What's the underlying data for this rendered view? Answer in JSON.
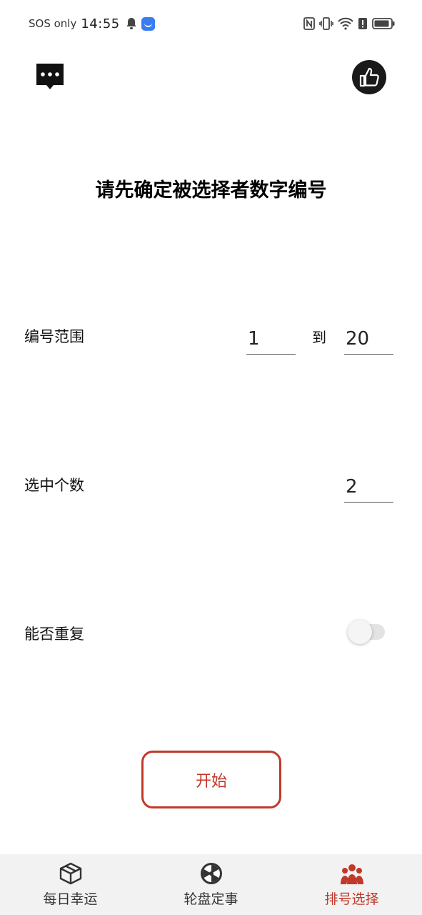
{
  "status_bar": {
    "carrier": "SOS only",
    "time": "14:55",
    "icons": [
      "bell-icon",
      "app-notification-icon",
      "nfc-icon",
      "vibrate-icon",
      "wifi-icon",
      "alert-icon",
      "battery-icon"
    ]
  },
  "top_bar": {
    "left_icon": "chat-bubble-icon",
    "right_icon": "thumbs-up-icon"
  },
  "heading": "请先确定被选择者数字编号",
  "range_row": {
    "label": "编号范围",
    "from_value": "1",
    "to_label": "到",
    "to_value": "20"
  },
  "count_row": {
    "label": "选中个数",
    "value": "2"
  },
  "repeat_row": {
    "label": "能否重复",
    "toggle_on": false
  },
  "start_button": "开始",
  "colors": {
    "accent": "#c0392b",
    "nav_background": "#f2f2f2"
  },
  "bottom_nav": {
    "active_index": 2,
    "items": [
      {
        "label": "每日幸运",
        "icon": "box-icon"
      },
      {
        "label": "轮盘定事",
        "icon": "wheel-icon"
      },
      {
        "label": "排号选择",
        "icon": "people-icon"
      }
    ]
  }
}
